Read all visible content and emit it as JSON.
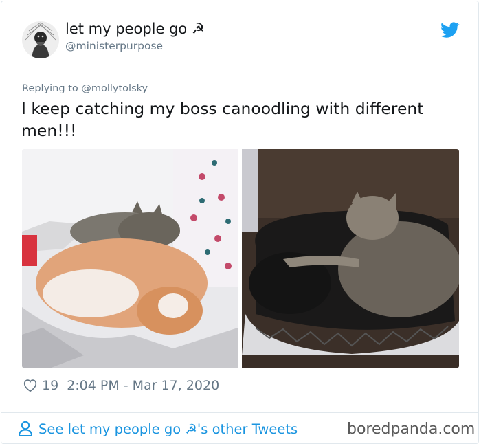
{
  "tweet": {
    "display_name": "let my people go ☭",
    "handle": "@ministerpurpose",
    "replying_prefix": "Replying to ",
    "replying_to": "@mollytolsky",
    "text": "I keep catching my boss canoodling with different men!!!",
    "like_count": "19",
    "timestamp": "2:04 PM - Mar 17, 2020",
    "footer_link": "See let my people go ☭'s other Tweets"
  },
  "icons": {
    "avatar": "avatar-portrait",
    "brand": "twitter-bird-icon",
    "like": "heart-icon",
    "profile": "person-icon"
  },
  "colors": {
    "twitter_blue": "#1da1f2",
    "link_blue": "#1b95e0",
    "secondary_text": "#657786",
    "border": "#e1e8ed"
  },
  "watermark": "boredpanda.com"
}
